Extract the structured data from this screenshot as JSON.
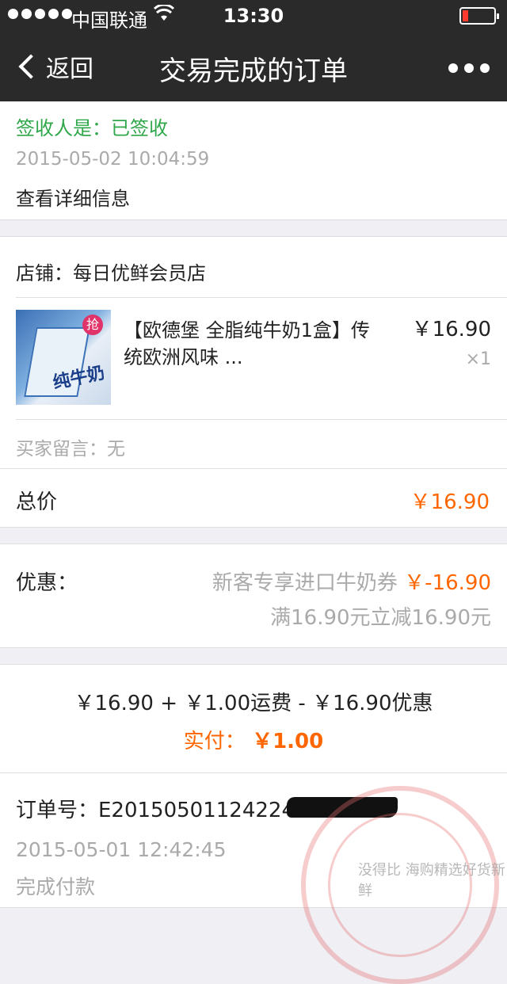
{
  "status_bar": {
    "carrier": "中国联通",
    "time": "13:30",
    "battery_color": "#ff3b30"
  },
  "nav": {
    "back_label": "返回",
    "title": "交易完成的订单",
    "more_icon": "more-dots-icon"
  },
  "receipt": {
    "signer_status": "签收人是：已签收",
    "sign_time": "2015-05-02 10:04:59",
    "details_link": "查看详细信息"
  },
  "store": {
    "name": "店铺：每日优鲜会员店"
  },
  "product": {
    "title_line1": "【欧德堡 全脂纯牛奶1盒】传",
    "title_line2": "统欧洲风味 ...",
    "price": "￥16.90",
    "quantity": "×1",
    "image_text": "纯牛奶",
    "badge_text": "抢"
  },
  "buyer_note": "买家留言：无",
  "total": {
    "label": "总价",
    "value": "￥16.90"
  },
  "discount": {
    "label": "优惠：",
    "coupon_name": "新客专享进口牛奶券",
    "coupon_value": "￥-16.90",
    "rule": "满16.90元立减16.90元"
  },
  "summary": {
    "formula": "￥16.90 + ￥1.00运费 - ￥16.90优惠",
    "paid_label": "实付：",
    "paid_value": "￥1.00"
  },
  "order": {
    "number": "订单号：E20150501124224",
    "created_time": "2015-05-01 12:42:45",
    "payment_status": "完成付款"
  },
  "watermark": {
    "text": "没得比  海购精选好货新鲜"
  },
  "colors": {
    "accent_orange": "#ff6600",
    "status_green": "#2fa74a",
    "nav_bg": "#2a2a2a"
  }
}
